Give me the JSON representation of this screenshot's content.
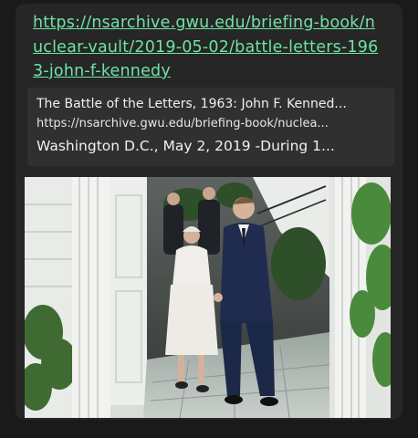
{
  "message": {
    "link_text": "https://nsarchive.gwu.edu/briefing-book/nuclear-vault/2019-05-02/battle-letters-1963-john-f-kennedy"
  },
  "preview": {
    "title": "The Battle of the Letters, 1963: John F. Kenned...",
    "url": "https://nsarchive.gwu.edu/briefing-book/nuclea...",
    "description": "Washington D.C., May 2, 2019 -During 1..."
  },
  "colors": {
    "link": "#6fe3a6",
    "bubble": "#262626",
    "preview_card": "#303030",
    "page_bg": "#1a1a1a"
  }
}
